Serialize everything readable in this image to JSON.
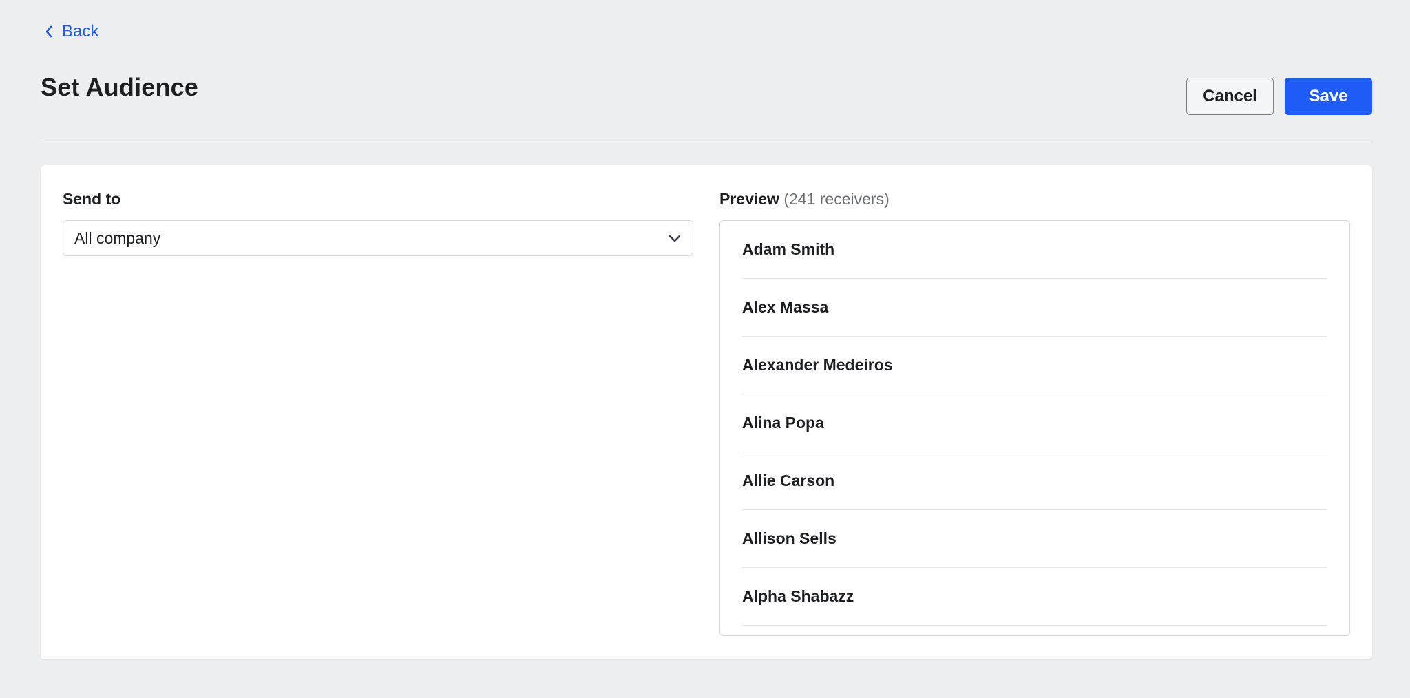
{
  "nav": {
    "back_label": "Back"
  },
  "header": {
    "title": "Set Audience",
    "cancel_label": "Cancel",
    "save_label": "Save"
  },
  "send_to": {
    "label": "Send to",
    "selected": "All company"
  },
  "preview": {
    "label": "Preview",
    "count_text": "(241 receivers)",
    "receivers": [
      "Adam Smith",
      "Alex Massa",
      "Alexander Medeiros",
      "Alina Popa",
      "Allie Carson",
      "Allison Sells",
      "Alpha Shabazz"
    ]
  },
  "colors": {
    "accent": "#1f5cf5",
    "link": "#2158e8",
    "background": "#edeef0"
  },
  "icons": {
    "back": "chevron-left-icon",
    "select": "chevron-down-icon"
  }
}
